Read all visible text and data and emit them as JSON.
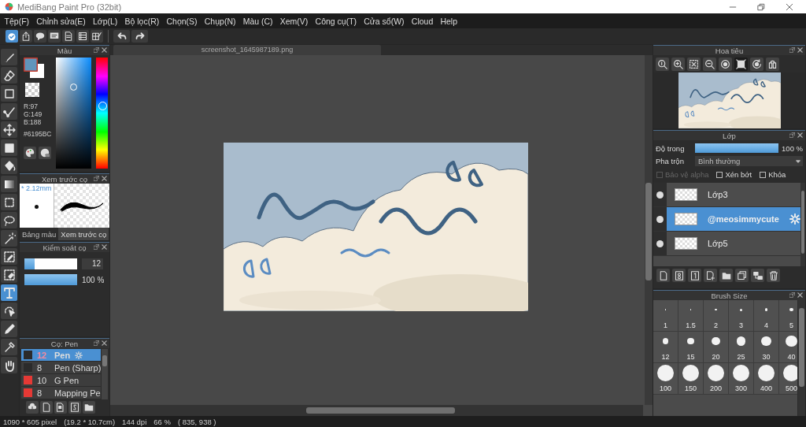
{
  "window": {
    "title": "MediBang Paint Pro (32bit)"
  },
  "menu": [
    "Tệp(F)",
    "Chỉnh sửa(E)",
    "Lớp(L)",
    "Bộ lọc(R)",
    "Chọn(S)",
    "Chụp(N)",
    "Màu (C)",
    "Xem(V)",
    "Công cụ(T)",
    "Cửa sổ(W)",
    "Cloud",
    "Help"
  ],
  "tools": [
    {
      "kind": "brush",
      "selected": false
    },
    {
      "kind": "eraser",
      "selected": false
    },
    {
      "kind": "shape",
      "selected": false
    },
    {
      "kind": "dotpen",
      "selected": false
    },
    {
      "kind": "move",
      "selected": false
    },
    {
      "kind": "fill",
      "selected": false
    },
    {
      "kind": "bucket",
      "selected": false
    },
    {
      "kind": "gradient",
      "selected": false
    },
    {
      "kind": "select",
      "selected": false
    },
    {
      "kind": "lasso",
      "selected": false
    },
    {
      "kind": "wand",
      "selected": false
    },
    {
      "kind": "selpen",
      "selected": false
    },
    {
      "kind": "selerase",
      "selected": false
    },
    {
      "kind": "text",
      "selected": true
    },
    {
      "kind": "objsel",
      "selected": false
    },
    {
      "kind": "pen",
      "selected": false
    },
    {
      "kind": "dropper",
      "selected": false
    },
    {
      "kind": "hand",
      "selected": false
    }
  ],
  "color_panel": {
    "title": "Màu",
    "r": "R:97",
    "g": "G:149",
    "b": "B:188",
    "hex": "#6195BC"
  },
  "brush_preview": {
    "title": "Xem trước cọ",
    "size": "* 2.12mm",
    "tabs": [
      {
        "label": "Bảng màu",
        "selected": false
      },
      {
        "label": "Xem trước cọ",
        "selected": true
      }
    ]
  },
  "brush_control": {
    "title": "Kiểm soát cọ",
    "size": {
      "level": 0.2,
      "value": "12"
    },
    "opacity": {
      "level": 1,
      "reading": "100 %"
    }
  },
  "brush_list": {
    "title": "Cọ: Pen",
    "items": [
      {
        "size": "12",
        "name": "Pen",
        "color": "#2b2b2b",
        "selected": true
      },
      {
        "size": "8",
        "name": "Pen (Sharp)",
        "color": "#2b2b2b",
        "selected": false
      },
      {
        "size": "10",
        "name": "G Pen",
        "color": "#e53935",
        "selected": false
      },
      {
        "size": "8",
        "name": "Mapping Pe",
        "color": "#e53935",
        "selected": false
      }
    ]
  },
  "document": {
    "tab": "screenshot_1645987189.png"
  },
  "navigator": {
    "title": "Hoa tiêu"
  },
  "layers": {
    "title": "Lớp",
    "opacity_label": "Độ trong",
    "opacity": {
      "level": 1,
      "reading": "100 %"
    },
    "blend_label": "Pha trộn",
    "blend_mode": "Bình thường",
    "options": [
      {
        "label": "Bảo vệ alpha",
        "checked": false,
        "disabled": true
      },
      {
        "label": "Xén bớt",
        "checked": false,
        "disabled": false
      },
      {
        "label": "Khóa",
        "checked": false,
        "disabled": false
      }
    ],
    "items": [
      {
        "name": "Lớp3",
        "selected": false
      },
      {
        "name": "@meosimmycute",
        "selected": true
      },
      {
        "name": "Lớp5",
        "selected": false
      }
    ]
  },
  "brush_size": {
    "title": "Brush Size",
    "sizes": [
      "1",
      "1.5",
      "2",
      "3",
      "4",
      "5",
      "12",
      "15",
      "20",
      "25",
      "30",
      "40",
      "100",
      "150",
      "200",
      "300",
      "400",
      "500"
    ]
  },
  "status_bar": [
    "1090 * 605 pixel",
    "(19.2 * 10.7cm)",
    "144 dpi",
    "66 %",
    "( 835, 938 )"
  ]
}
